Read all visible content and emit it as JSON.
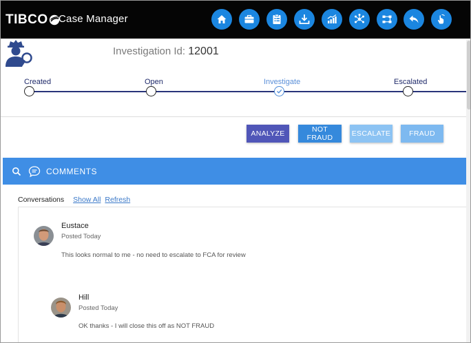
{
  "header": {
    "logo": "TIBCO",
    "app_title": "Case Manager",
    "nav_icons": [
      "home-icon",
      "briefcase-icon",
      "clipboard-icon",
      "download-tray-icon",
      "bar-chart-icon",
      "network-icon",
      "workflow-icon",
      "reply-icon",
      "hand-pointer-icon"
    ]
  },
  "investigation": {
    "label": "Investigation Id:",
    "id": "12001"
  },
  "timeline": {
    "steps": [
      {
        "label": "Created",
        "active": false
      },
      {
        "label": "Open",
        "active": false
      },
      {
        "label": "Investigate",
        "active": true
      },
      {
        "label": "Escalated",
        "active": false
      }
    ]
  },
  "actions": [
    {
      "label": "ANALYZE",
      "color": "#5056b8"
    },
    {
      "label": "NOT FRAUD",
      "color": "#3589dc"
    },
    {
      "label": "ESCALATE",
      "color": "#8cc3f3"
    },
    {
      "label": "FRAUD",
      "color": "#7db9f0"
    }
  ],
  "comments": {
    "title": "COMMENTS",
    "bar_color": "#3f8ee5",
    "conversations_label": "Conversations",
    "show_all": "Show All",
    "refresh": "Refresh",
    "items": [
      {
        "name": "Eustace",
        "posted": "Posted Today",
        "text": "This looks normal to me - no need to escalate to FCA for review"
      },
      {
        "name": "Hill",
        "posted": "Posted Today",
        "text": "OK thanks - I will close this off as NOT FRAUD"
      }
    ]
  }
}
